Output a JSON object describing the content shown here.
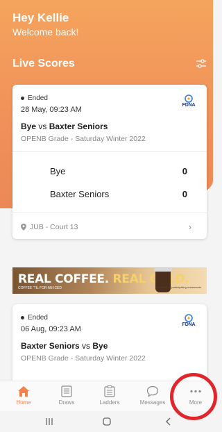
{
  "header": {
    "greeting": "Hey Kellie",
    "subtitle": "Welcome back!",
    "section_title": "Live Scores"
  },
  "matches": [
    {
      "status": "Ended",
      "datetime": "28 May, 09:23 AM",
      "team_a": "Bye",
      "vs": "vs",
      "team_b": "Baxter Seniors",
      "grade": "OPENB Grade - Saturday Winter 2022",
      "logo_text": "FDNA",
      "scores": [
        {
          "team": "Bye",
          "score": "0"
        },
        {
          "team": "Baxter Seniors",
          "score": "0"
        }
      ],
      "venue": "JUB - Court 13"
    },
    {
      "status": "Ended",
      "datetime": "06 Aug, 09:23 AM",
      "team_a": "Baxter Seniors",
      "vs": "vs",
      "team_b": "Bye",
      "grade": "OPENB Grade - Saturday Winter 2022",
      "logo_text": "FDNA"
    }
  ],
  "ad_banner": {
    "headline_part1": "REAL COFFEE.",
    "headline_part2": "REAL COLD.",
    "tagline": "COFFEE 'TIL FOR AN ICED",
    "fineprint": "Available at participating restaurants"
  },
  "nav": [
    {
      "label": "Home",
      "icon": "home-icon",
      "active": true
    },
    {
      "label": "Draws",
      "icon": "draws-icon",
      "active": false
    },
    {
      "label": "Ladders",
      "icon": "ladders-icon",
      "active": false
    },
    {
      "label": "Messages",
      "icon": "messages-icon",
      "active": false
    },
    {
      "label": "More",
      "icon": "more-icon",
      "active": false
    }
  ],
  "colors": {
    "accent": "#f0824a",
    "hero_top": "#f5a45d",
    "highlight_ring": "#e0262c"
  }
}
